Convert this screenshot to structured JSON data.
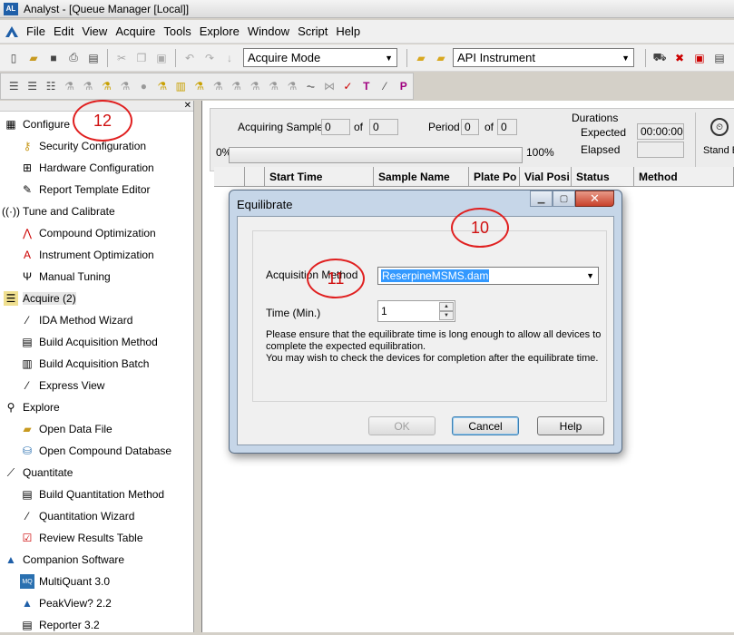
{
  "window": {
    "title": "Analyst - [Queue Manager [Local]]",
    "logo_text": "AL"
  },
  "menu": [
    "File",
    "Edit",
    "View",
    "Acquire",
    "Tools",
    "Explore",
    "Window",
    "Script",
    "Help"
  ],
  "toolbar": {
    "mode": "Acquire Mode",
    "instrument": "API Instrument"
  },
  "nav": {
    "configure": "Configure",
    "security_configuration": "Security Configuration",
    "hardware_configuration": "Hardware Configuration",
    "report_template_editor": "Report Template Editor",
    "tune_and_calibrate": "Tune and Calibrate",
    "compound_optimization": "Compound Optimization",
    "instrument_optimization": "Instrument Optimization",
    "manual_tuning": "Manual Tuning",
    "acquire": "Acquire  (2)",
    "ida_method_wizard": "IDA Method Wizard",
    "build_acquisition_method": "Build Acquisition Method",
    "build_acquisition_batch": "Build Acquisition Batch",
    "express_view": "Express View",
    "explore": "Explore",
    "open_data_file": "Open Data File",
    "open_compound_database": "Open Compound Database",
    "quantitate": "Quantitate",
    "build_quantitation_method": "Build Quantitation Method",
    "quantitation_wizard": "Quantitation Wizard",
    "review_results_table": "Review Results Table",
    "companion_software": "Companion Software",
    "multiquant": "MultiQuant 3.0",
    "peakview": "PeakView? 2.2",
    "reporter": "Reporter 3.2"
  },
  "status": {
    "acquiring_sample": "Acquiring Sample",
    "sample_value": "0",
    "of": "of",
    "sample_total": "0",
    "period": "Period",
    "period_value": "0",
    "period_total": "0",
    "durations": "Durations",
    "expected": "Expected",
    "expected_value": "00:00:00",
    "elapsed": "Elapsed",
    "progress_start": "0%",
    "progress_end": "100%",
    "progress_fraction": 0,
    "stand_by": "Stand B"
  },
  "grid_columns": [
    "",
    "",
    "Start Time",
    "Sample Name",
    "Plate Po",
    "Vial Posi",
    "Status",
    "Method"
  ],
  "dialog": {
    "title": "Equilibrate",
    "acq_method_label": "Acquisition Method",
    "acq_method_value": "ReserpineMSMS.dam",
    "time_label": "Time (Min.)",
    "time_value": "1",
    "note": "Please ensure that the equilibrate time is long enough to allow all devices to complete the expected equilibration.\nYou may wish to check the devices for completion after the equilibrate time.",
    "ok": "OK",
    "cancel": "Cancel",
    "help": "Help"
  },
  "callouts": {
    "a": "10",
    "b": "11",
    "c": "12"
  },
  "colors": {
    "selection": "#3399ff",
    "callout": "#e02020",
    "dialog_frame": "#c6d6e8"
  }
}
